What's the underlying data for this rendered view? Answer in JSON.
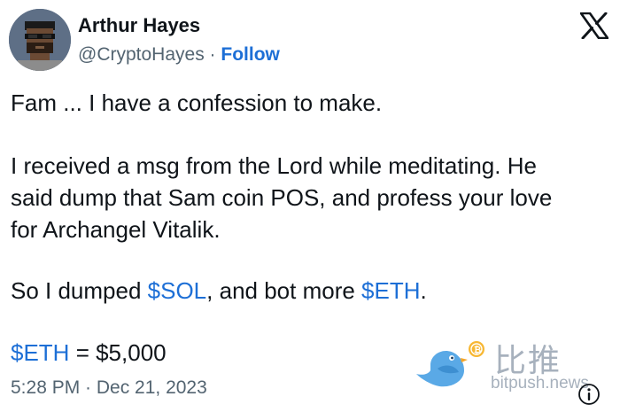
{
  "author": {
    "name": "Arthur Hayes",
    "handle": "@CryptoHayes",
    "separator": " · ",
    "follow_label": "Follow",
    "avatar_icon": "pixel-avatar-icon"
  },
  "platform_icon": "x-logo-icon",
  "tweet": {
    "line1": "Fam ... I have a confession to make.",
    "line2": "I received a msg from the Lord while meditating. He",
    "line3": "said dump that Sam coin POS, and profess your love",
    "line4": "for Archangel Vitalik.",
    "line5_a": "So I dumped ",
    "line5_tag1": "$SOL",
    "line5_b": ", and bot more ",
    "line5_tag2": "$ETH",
    "line5_c": ".",
    "line6_tag": "$ETH",
    "line6_rest": " = $5,000"
  },
  "timestamp": "5:28 PM · Dec 21, 2023",
  "watermark": {
    "brand_cn": "比推",
    "url": "bitpush.news",
    "bird_icon": "bird-logo-icon"
  },
  "info_icon": "info-icon",
  "colors": {
    "link": "#1d6fd6",
    "text": "#0f1419",
    "secondary": "#536471",
    "watermark": "#a7b1bd"
  }
}
